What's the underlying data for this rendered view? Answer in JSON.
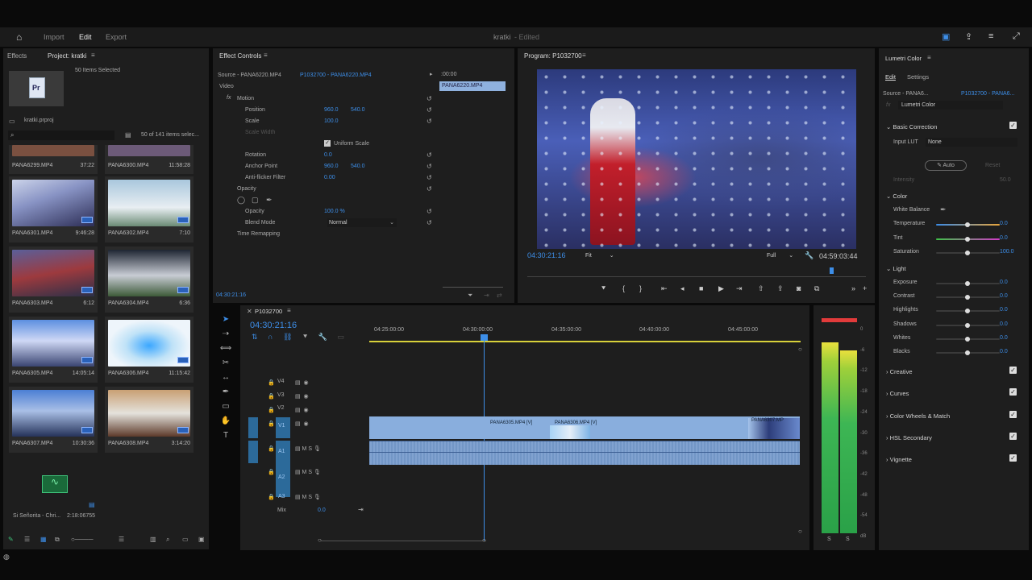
{
  "topbar": {
    "home_icon": "home-icon",
    "import": "Import",
    "edit": "Edit",
    "export": "Export",
    "project_title": "kratki",
    "edited_status": "- Edited"
  },
  "project_panel": {
    "tab_effects": "Effects",
    "tab_project": "Project: kratki",
    "items_selected": "50 Items Selected",
    "project_file": "kratki.prproj",
    "items_count": "50 of 141 items selec...",
    "clips": [
      {
        "name": "PANA6299.MP4",
        "duration": "37:22"
      },
      {
        "name": "PANA6300.MP4",
        "duration": "11:58:28"
      },
      {
        "name": "PANA6301.MP4",
        "duration": "9:46:28"
      },
      {
        "name": "PANA6302.MP4",
        "duration": "7:10"
      },
      {
        "name": "PANA6303.MP4",
        "duration": "6:12"
      },
      {
        "name": "PANA6304.MP4",
        "duration": "6:36"
      },
      {
        "name": "PANA6305.MP4",
        "duration": "14:05:14"
      },
      {
        "name": "PANA6306.MP4",
        "duration": "11:15:42"
      },
      {
        "name": "PANA6307.MP4",
        "duration": "10:30:36"
      },
      {
        "name": "PANA6308.MP4",
        "duration": "3:14:20"
      }
    ],
    "audio_item": {
      "name": "Si Señorita - Chri...",
      "duration": "2:18:06755"
    }
  },
  "effect_controls": {
    "tab": "Effect Controls",
    "source": "Source - PANA6220.MP4",
    "sequence": "P1032700 - PANA6220.MP4",
    "clip_label": "PANA6220.MP4",
    "time_ruler": ":00:00",
    "video": "Video",
    "motion": "Motion",
    "position_label": "Position",
    "position_x": "960.0",
    "position_y": "540.0",
    "scale_label": "Scale",
    "scale_value": "100.0",
    "scale_width_label": "Scale Width",
    "uniform_scale": "Uniform Scale",
    "rotation_label": "Rotation",
    "rotation_value": "0.0",
    "anchor_label": "Anchor Point",
    "anchor_x": "960.0",
    "anchor_y": "540.0",
    "flicker_label": "Anti-flicker Filter",
    "flicker_value": "0.00",
    "opacity_section": "Opacity",
    "opacity_label": "Opacity",
    "opacity_value": "100.0 %",
    "blend_label": "Blend Mode",
    "blend_value": "Normal",
    "time_remap": "Time Remapping",
    "timecode": "04:30:21:16"
  },
  "program": {
    "title": "Program: P1032700",
    "timecode": "04:30:21:16",
    "fit": "Fit",
    "quality": "Full",
    "duration": "04:59:03:44"
  },
  "timeline": {
    "tab": "P1032700",
    "timecode": "04:30:21:16",
    "ruler": [
      "04:25:00:00",
      "04:30:00:00",
      "04:35:00:00",
      "04:40:00:00",
      "04:45:00:00"
    ],
    "tracks": [
      "V4",
      "V3",
      "V2",
      "V1",
      "A1",
      "A2",
      "A3"
    ],
    "mix_label": "Mix",
    "mix_value": "0.0",
    "clips": [
      "PANA6305.MP4 [V]",
      "PANA6306.MP4 [V]",
      "PANA6307.MP"
    ]
  },
  "meter": {
    "ticks": [
      "0",
      "-6",
      "-12",
      "-18",
      "-24",
      "-30",
      "-36",
      "-42",
      "-48",
      "-54",
      "dB"
    ],
    "solo": [
      "S",
      "S"
    ]
  },
  "lumetri": {
    "title": "Lumetri Color",
    "tab_edit": "Edit",
    "tab_settings": "Settings",
    "source": "Source - PANA6...",
    "sequence": "P1032700 - PANA6...",
    "effect": "Lumetri Color",
    "basic": "Basic Correction",
    "input_lut": "Input LUT",
    "input_lut_value": "None",
    "auto": "Auto",
    "reset": "Reset",
    "intensity": "Intensity",
    "intensity_value": "50.0",
    "color": "Color",
    "white_balance": "White Balance",
    "temperature": "Temperature",
    "temperature_value": "0.0",
    "tint": "Tint",
    "tint_value": "0.0",
    "saturation": "Saturation",
    "saturation_value": "100.0",
    "light": "Light",
    "exposure": "Exposure",
    "exposure_value": "0.0",
    "contrast": "Contrast",
    "contrast_value": "0.0",
    "highlights": "Highlights",
    "highlights_value": "0.0",
    "shadows": "Shadows",
    "shadows_value": "0.0",
    "whites": "Whites",
    "whites_value": "0.0",
    "blacks": "Blacks",
    "blacks_value": "0.0",
    "creative": "Creative",
    "curves": "Curves",
    "wheels": "Color Wheels & Match",
    "hsl": "HSL Secondary",
    "vignette": "Vignette"
  }
}
